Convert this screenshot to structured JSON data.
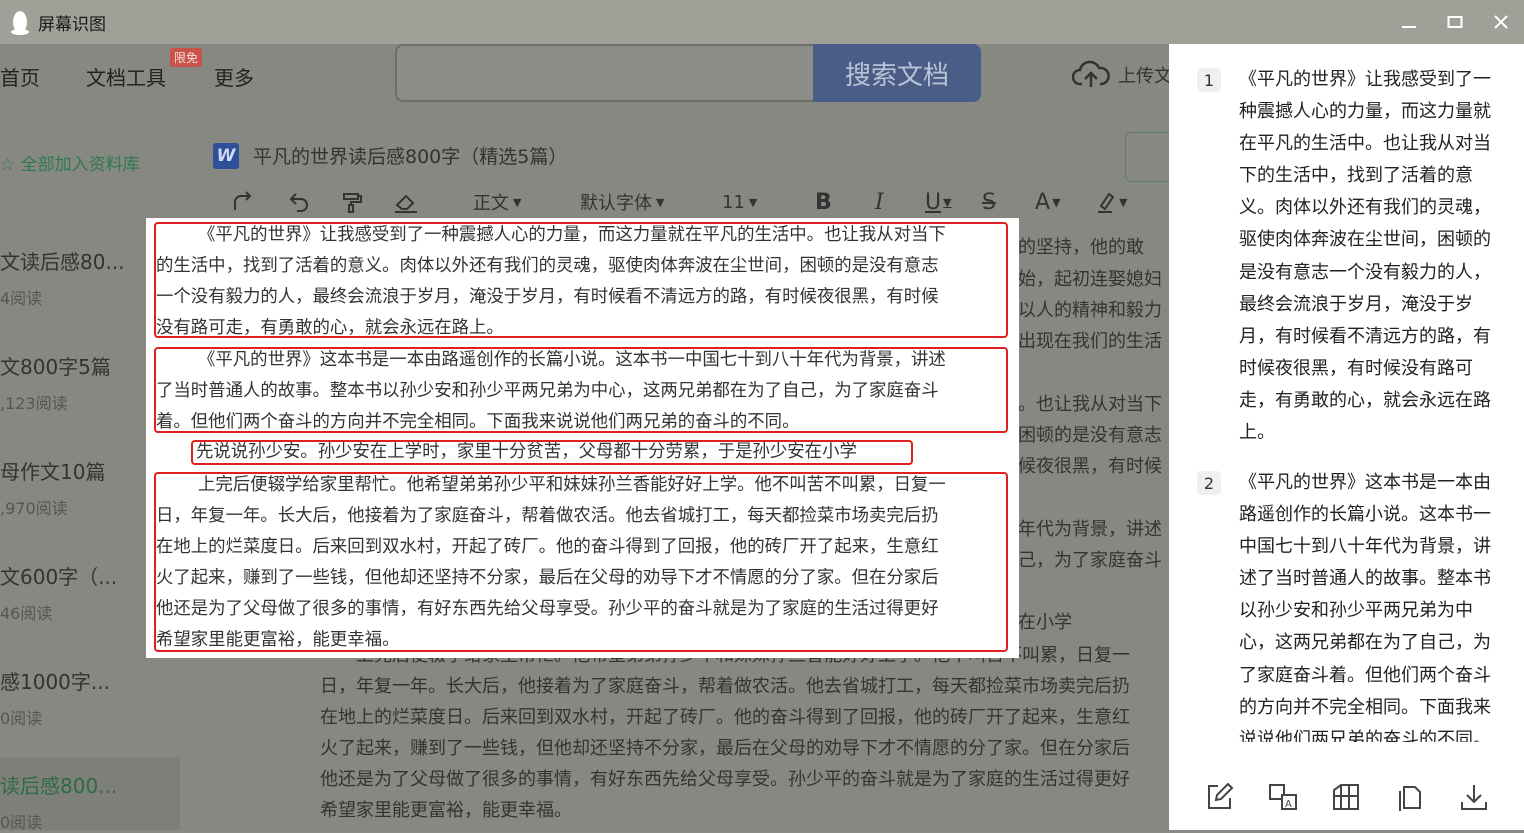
{
  "window": {
    "title": "屏幕识图"
  },
  "nav": {
    "home": "首页",
    "doc_tools": "文档工具",
    "badge": "限免",
    "more": "更多",
    "search_button": "搜索文档",
    "upload": "上传文"
  },
  "sidebar": {
    "add_all": "全部加入资料库",
    "items": [
      {
        "title": "文读后感80...",
        "sub": "4阅读"
      },
      {
        "title": "文800字5篇",
        "sub": ",123阅读"
      },
      {
        "title": "母作文10篇",
        "sub": ",970阅读"
      },
      {
        "title": "文600字（...",
        "sub": "46阅读"
      },
      {
        "title": "感1000字...",
        "sub": "0阅读"
      },
      {
        "title": "读后感800...",
        "sub": "0阅读"
      }
    ]
  },
  "document": {
    "title": "平凡的世界读后感800字（精选5篇）",
    "style": "正文",
    "font": "默认字体",
    "size": "11",
    "bg_right_lines": [
      "的坚持，他的敢",
      "始，起初连娶媳妇",
      "以人的精神和毅力",
      "出现在我们的生活",
      "。也让我从对当下",
      "困顿的是没有意志",
      "候夜很黑，有时候",
      "年代为背景，讲述",
      "己，为了家庭奋斗",
      "在小学"
    ],
    "bg_bottom_lines": [
      "上完后便辍学给家里帮忙。他希望弟弟孙少平和妹妹孙兰香能好好上学。他不叫苦不叫累，日复一",
      "日，年复一年。长大后，他接着为了家庭奋斗，帮着做农活。他去省城打工，每天都捡菜市场卖完后扔",
      "在地上的烂菜度日。后来回到双水村，开起了砖厂。他的奋斗得到了回报，他的砖厂开了起来，生意红",
      "火了起来，赚到了一些钱，但他却还坚持不分家，最后在父母的劝导下才不情愿的分了家。但在分家后",
      "他还是为了父母做了很多的事情，有好东西先给父母享受。孙少平的奋斗就是为了家庭的生活过得更好",
      "希望家里能更富裕，能更幸福。"
    ]
  },
  "overlay": {
    "block1": [
      "《平凡的世界》让我感受到了一种震撼人心的力量，而这力量就在平凡的生活中。也让我从对当下",
      "的生活中，找到了活着的意义。肉体以外还有我们的灵魂，驱使肉体奔波在尘世间，困顿的是没有意志",
      "一个没有毅力的人，最终会流浪于岁月，淹没于岁月，有时候看不清远方的路，有时候夜很黑，有时候",
      "没有路可走，有勇敢的心，就会永远在路上。"
    ],
    "block2": [
      "《平凡的世界》这本书是一本由路遥创作的长篇小说。这本书一中国七十到八十年代为背景，讲述",
      "了当时普通人的故事。整本书以孙少安和孙少平两兄弟为中心，这两兄弟都在为了自己，为了家庭奋斗",
      "着。但他们两个奋斗的方向并不完全相同。下面我来说说他们两兄弟的奋斗的不同。"
    ],
    "block3": [
      "先说说孙少安。孙少安在上学时，家里十分贫苦，父母都十分劳累，于是孙少安在小学"
    ],
    "block4": [
      "上完后便辍学给家里帮忙。他希望弟弟孙少平和妹妹孙兰香能好好上学。他不叫苦不叫累，日复一",
      "日，年复一年。长大后，他接着为了家庭奋斗，帮着做农活。他去省城打工，每天都捡菜市场卖完后扔",
      "在地上的烂菜度日。后来回到双水村，开起了砖厂。他的奋斗得到了回报，他的砖厂开了起来，生意红",
      "火了起来，赚到了一些钱，但他却还坚持不分家，最后在父母的劝导下才不情愿的分了家。但在分家后",
      "他还是为了父母做了很多的事情，有好东西先给父母享受。孙少平的奋斗就是为了家庭的生活过得更好",
      "希望家里能更富裕，能更幸福。"
    ]
  },
  "panel": {
    "results": [
      {
        "num": "1",
        "text": "《平凡的世界》让我感受到了一种震撼人心的力量，而这力量就在平凡的生活中。也让我从对当下的生活中，找到了活着的意义。肉体以外还有我们的灵魂，驱使肉体奔波在尘世间，困顿的是没有意志一个没有毅力的人，最终会流浪于岁月，淹没于岁月，有时候看不清远方的路，有时候夜很黑，有时候没有路可走，有勇敢的心，就会永远在路上。"
      },
      {
        "num": "2",
        "text": "《平凡的世界》这本书是一本由路遥创作的长篇小说。这本书一中国七十到八十年代为背景，讲述了当时普通人的故事。整本书以孙少安和孙少平两兄弟为中心，这两兄弟都在为了自己，为了家庭奋斗着。但他们两个奋斗的方向并不完全相同。下面我来说说他们两兄弟的奋斗的不同。"
      }
    ],
    "icons": [
      "edit-icon",
      "translate-icon",
      "layout-icon",
      "copy-icon",
      "download-icon"
    ]
  }
}
